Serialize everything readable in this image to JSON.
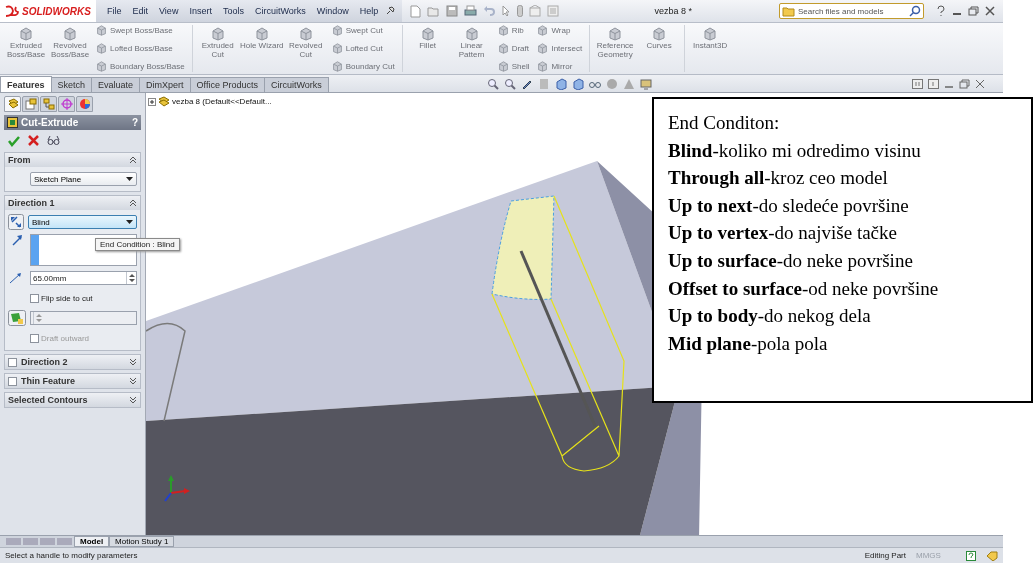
{
  "app": {
    "logo": "SOLIDWORKS"
  },
  "menu": [
    "File",
    "Edit",
    "View",
    "Insert",
    "Tools",
    "CircuitWorks",
    "Window",
    "Help"
  ],
  "document_title": "vezba 8 *",
  "search": {
    "placeholder": "Search files and models"
  },
  "ribbon": [
    {
      "kind": "large",
      "label": "Extruded Boss/Base"
    },
    {
      "kind": "large",
      "label": "Revolved Boss/Base"
    },
    {
      "kind": "stack",
      "items": [
        "Swept Boss/Base",
        "Lofted Boss/Base",
        "Boundary Boss/Base"
      ]
    },
    {
      "kind": "separator"
    },
    {
      "kind": "large",
      "label": "Extruded Cut"
    },
    {
      "kind": "large",
      "label": "Hole Wizard"
    },
    {
      "kind": "large",
      "label": "Revolved Cut"
    },
    {
      "kind": "stack",
      "items": [
        "Swept Cut",
        "Lofted Cut",
        "Boundary Cut"
      ]
    },
    {
      "kind": "separator"
    },
    {
      "kind": "large",
      "label": "Fillet"
    },
    {
      "kind": "large",
      "label": "Linear Pattern"
    },
    {
      "kind": "stack",
      "items": [
        "Rib",
        "Draft",
        "Shell"
      ]
    },
    {
      "kind": "stack",
      "items": [
        "Wrap",
        "Intersect",
        "Mirror"
      ]
    },
    {
      "kind": "separator"
    },
    {
      "kind": "large",
      "label": "Reference Geometry"
    },
    {
      "kind": "large",
      "label": "Curves"
    },
    {
      "kind": "separator"
    },
    {
      "kind": "large",
      "label": "Instant3D"
    }
  ],
  "command_tabs": [
    {
      "label": "Features",
      "selected": true
    },
    {
      "label": "Sketch",
      "selected": false
    },
    {
      "label": "Evaluate",
      "selected": false
    },
    {
      "label": "DimXpert",
      "selected": false
    },
    {
      "label": "Office Products",
      "selected": false
    },
    {
      "label": "CircuitWorks",
      "selected": false
    }
  ],
  "panel_tabs": [
    {
      "selected": true
    },
    {
      "selected": false
    },
    {
      "selected": false
    },
    {
      "selected": false
    },
    {
      "selected": false
    }
  ],
  "property_manager": {
    "title": "Cut-Extrude",
    "help": "?",
    "sections": [
      {
        "title": "From",
        "expanded": true,
        "rows": [
          {
            "kind": "dropdown",
            "value": "Sketch Plane"
          }
        ]
      },
      {
        "title": "Direction 1",
        "expanded": true,
        "rows": [
          {
            "kind": "dropdown",
            "value": "Blind",
            "focused": true
          },
          {
            "kind": "selection"
          },
          {
            "kind": "spinner",
            "value": "65.00mm"
          },
          {
            "kind": "checkbox",
            "label": "Flip side to cut",
            "checked": false,
            "disabled": false
          },
          {
            "kind": "draft"
          },
          {
            "kind": "checkbox",
            "label": "Draft outward",
            "checked": false,
            "disabled": true
          }
        ]
      },
      {
        "title": "Direction 2",
        "expanded": false,
        "checkbox": {
          "checked": false
        }
      },
      {
        "title": "Thin Feature",
        "expanded": false,
        "checkbox": {
          "checked": false
        }
      },
      {
        "title": "Selected Contours",
        "expanded": false
      }
    ]
  },
  "tooltip": "End Condition : Blind",
  "feature_tree": {
    "label": "vezba 8  (Default<<Default..."
  },
  "annotation": {
    "title": "End Conditon:",
    "lines": [
      "**Blind**-koliko mi odredimo visinu",
      "**Through all**-kroz ceo model",
      "**Up to next**-do sledeće površine",
      "**Up to vertex**-do najviše tačke",
      "**Up to surface**-do neke površine",
      "**Offset to surface**-od neke površine",
      "**Up to body**-do nekog dela",
      "**Mid plane**-pola pola"
    ]
  },
  "bottom_tabs": [
    {
      "label": "Model",
      "selected": true
    },
    {
      "label": "Motion Study 1",
      "selected": false
    }
  ],
  "status_bar": {
    "message": "Select a handle to modify parameters",
    "mode": "Editing Part",
    "units": "MMGS"
  }
}
